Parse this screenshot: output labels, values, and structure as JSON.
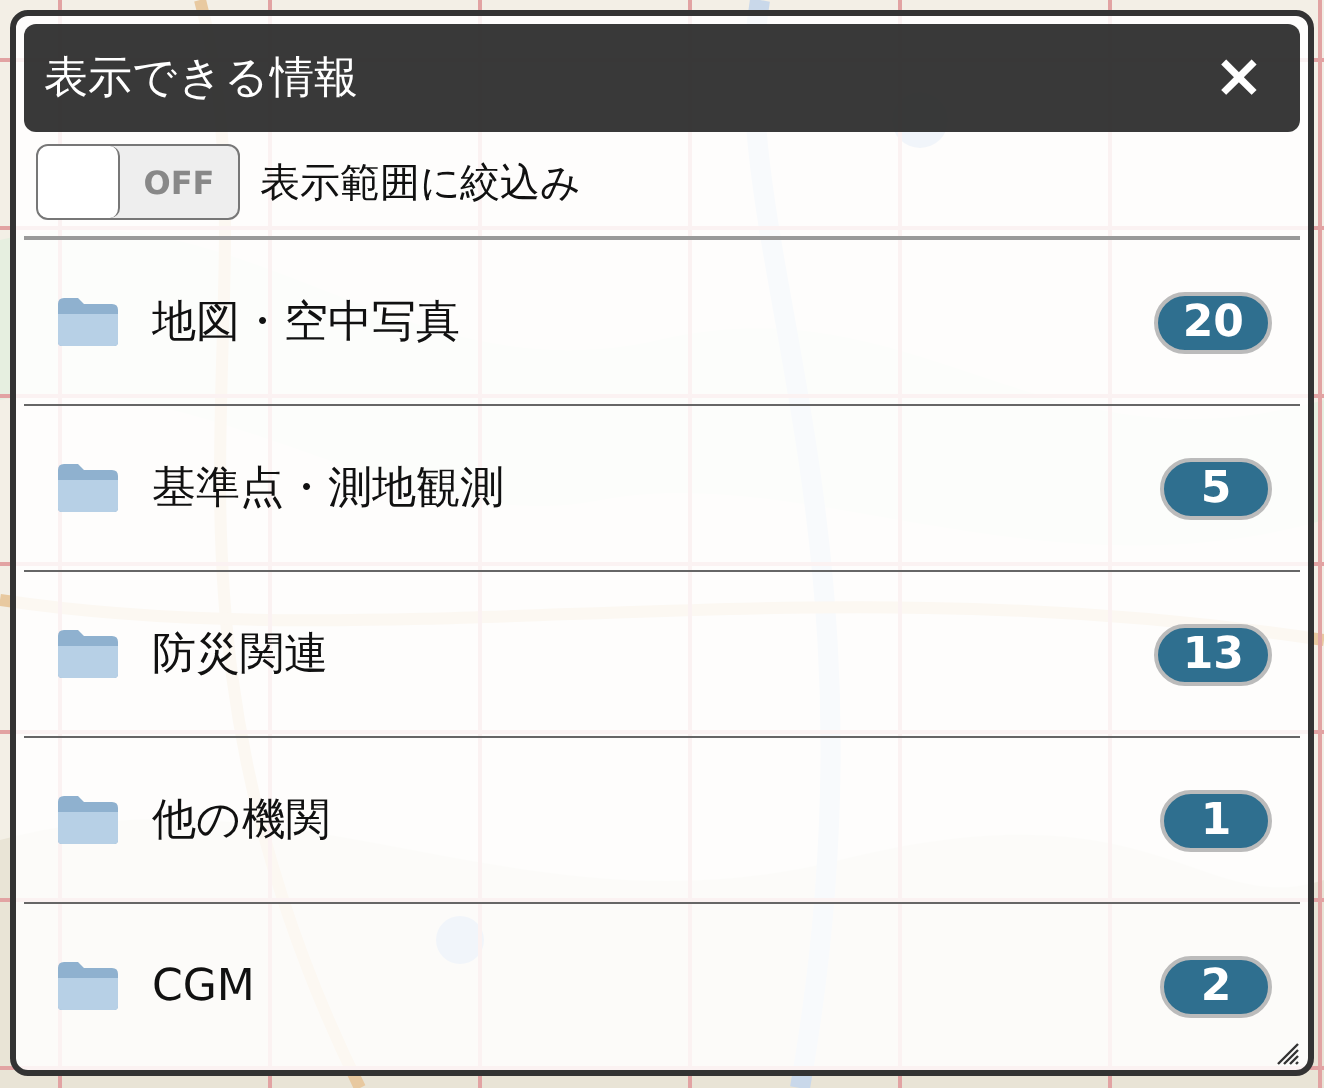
{
  "panel": {
    "title": "表示できる情報",
    "close": "×"
  },
  "filter": {
    "on": false,
    "switch_label": "OFF",
    "label": "表示範囲に絞込み"
  },
  "folders": [
    {
      "name": "地図・空中写真",
      "count": "20"
    },
    {
      "name": "基準点・測地観測",
      "count": "5"
    },
    {
      "name": "防災関連",
      "count": "13"
    },
    {
      "name": "他の機関",
      "count": "1"
    },
    {
      "name": "CGM",
      "count": "2"
    }
  ]
}
